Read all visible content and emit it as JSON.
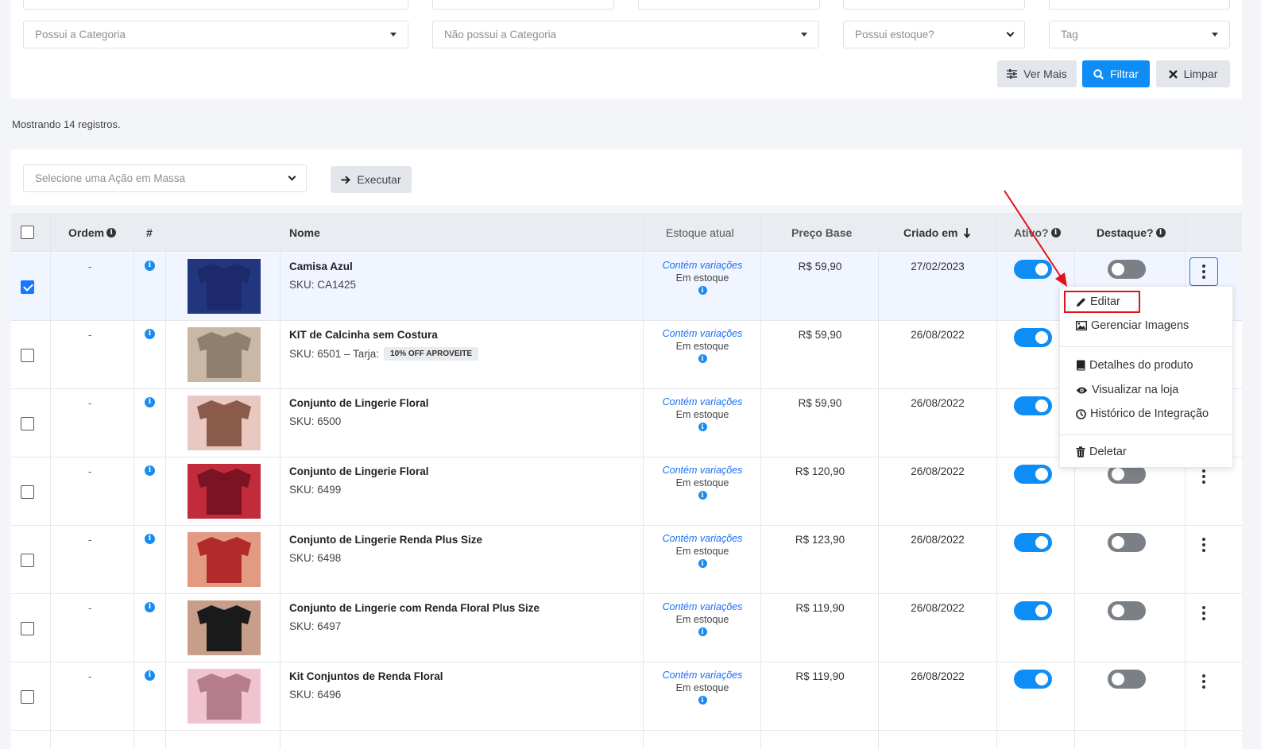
{
  "filters": {
    "categoria": "Possui a Categoria",
    "nao_categoria": "Não possui a Categoria",
    "estoque": "Possui estoque?",
    "tag": "Tag",
    "ver_mais": "Ver Mais",
    "filtrar": "Filtrar",
    "limpar": "Limpar"
  },
  "count_text": "Mostrando 14 registros.",
  "bulk": {
    "placeholder": "Selecione uma Ação em Massa",
    "executar": "Executar"
  },
  "table": {
    "headers": {
      "ordem": "Ordem",
      "hash": "#",
      "nome": "Nome",
      "estoque": "Estoque atual",
      "preco": "Preço Base",
      "criado": "Criado em",
      "ativo": "Ativo?",
      "destaque": "Destaque?"
    },
    "rows": [
      {
        "ordem": "-",
        "nome": "Camisa Azul",
        "sku": "SKU: CA1425",
        "tag": "",
        "variacoes": "Contém variações",
        "estoque": "Em estoque",
        "preco": "R$ 59,90",
        "data": "27/02/2023",
        "ativo": true,
        "destaque": false,
        "selected": true
      },
      {
        "ordem": "-",
        "nome": "KIT de Calcinha sem Costura",
        "sku": "SKU: 6501 – Tarja:",
        "tag": "10% OFF APROVEITE",
        "variacoes": "Contém variações",
        "estoque": "Em estoque",
        "preco": "R$ 59,90",
        "data": "26/08/2022",
        "ativo": true,
        "destaque": false,
        "selected": false
      },
      {
        "ordem": "-",
        "nome": "Conjunto de Lingerie Floral",
        "sku": "SKU: 6500",
        "tag": "",
        "variacoes": "Contém variações",
        "estoque": "Em estoque",
        "preco": "R$ 59,90",
        "data": "26/08/2022",
        "ativo": true,
        "destaque": false,
        "selected": false
      },
      {
        "ordem": "-",
        "nome": "Conjunto de Lingerie Floral",
        "sku": "SKU: 6499",
        "tag": "",
        "variacoes": "Contém variações",
        "estoque": "Em estoque",
        "preco": "R$ 120,90",
        "data": "26/08/2022",
        "ativo": true,
        "destaque": false,
        "selected": false
      },
      {
        "ordem": "-",
        "nome": "Conjunto de Lingerie Renda Plus Size",
        "sku": "SKU: 6498",
        "tag": "",
        "variacoes": "Contém variações",
        "estoque": "Em estoque",
        "preco": "R$ 123,90",
        "data": "26/08/2022",
        "ativo": true,
        "destaque": false,
        "selected": false
      },
      {
        "ordem": "-",
        "nome": "Conjunto de Lingerie com Renda Floral Plus Size",
        "sku": "SKU: 6497",
        "tag": "",
        "variacoes": "Contém variações",
        "estoque": "Em estoque",
        "preco": "R$ 119,90",
        "data": "26/08/2022",
        "ativo": true,
        "destaque": false,
        "selected": false
      },
      {
        "ordem": "-",
        "nome": "Kit Conjuntos de Renda Floral",
        "sku": "SKU: 6496",
        "tag": "",
        "variacoes": "Contém variações",
        "estoque": "Em estoque",
        "preco": "R$ 119,90",
        "data": "26/08/2022",
        "ativo": true,
        "destaque": false,
        "selected": false
      }
    ]
  },
  "menu": {
    "editar": "Editar",
    "imagens": "Gerenciar Imagens",
    "detalhes": "Detalhes do produto",
    "visualizar": "Visualizar na loja",
    "historico": "Histórico de Integração",
    "deletar": "Deletar"
  },
  "colors": {
    "primary": "#0d8df5",
    "highlight": "#e0131a",
    "toggle_off": "#7b8087"
  }
}
